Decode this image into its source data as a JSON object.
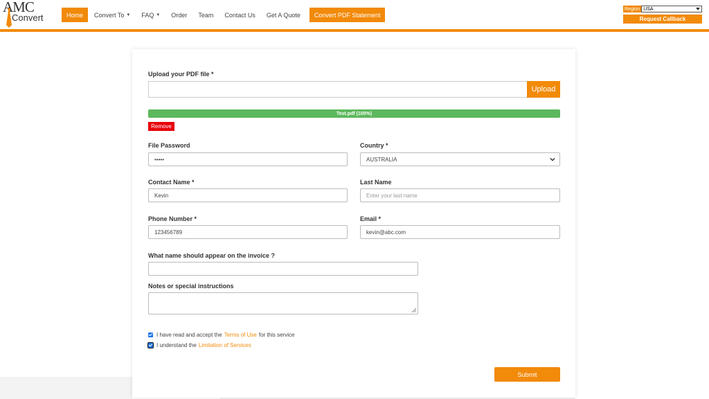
{
  "header": {
    "logo": {
      "top": "AMC",
      "bottom": "Convert"
    },
    "nav": [
      {
        "label": "Home",
        "active": true,
        "dropdown": false
      },
      {
        "label": "Convert To",
        "active": false,
        "dropdown": true
      },
      {
        "label": "FAQ",
        "active": false,
        "dropdown": true
      },
      {
        "label": "Order",
        "active": false,
        "dropdown": false
      },
      {
        "label": "Team",
        "active": false,
        "dropdown": false
      },
      {
        "label": "Contact Us",
        "active": false,
        "dropdown": false
      },
      {
        "label": "Get A Quote",
        "active": false,
        "dropdown": false
      },
      {
        "label": "Convert PDF Statement",
        "active": false,
        "dropdown": false
      }
    ],
    "region": {
      "label": "Region",
      "value": "USA"
    },
    "callback_label": "Request Callback"
  },
  "form": {
    "upload": {
      "label": "Upload your PDF file *",
      "button": "Upload",
      "value": ""
    },
    "progress": {
      "text": "Test.pdf (100%)",
      "percent": 100
    },
    "remove_label": "Remove",
    "file_password": {
      "label": "File Password",
      "value": "•••••"
    },
    "country": {
      "label": "Country *",
      "value": "AUSTRALIA"
    },
    "contact_name": {
      "label": "Contact Name *",
      "value": "Kevin"
    },
    "last_name": {
      "label": "Last Name",
      "placeholder": "Enter your last name"
    },
    "phone": {
      "label": "Phone Number *",
      "value": "123456789"
    },
    "email": {
      "label": "Email *",
      "value": "kevin@abc.com"
    },
    "invoice_name": {
      "label": "What name should appear on the invoice ?",
      "value": ""
    },
    "notes": {
      "label": "Notes or special instructions",
      "value": ""
    },
    "terms": {
      "prefix": "I have read and accept the",
      "link": "Terms of Use",
      "suffix": "for this service",
      "checked": true
    },
    "limitation": {
      "prefix": "I understand the",
      "link": "Limitation of Services",
      "checked": true
    },
    "submit_label": "Submit"
  },
  "colors": {
    "accent": "#f28a0a",
    "progress": "#5cb85c",
    "remove": "#e8000a",
    "checkbox": "#1a73e8"
  }
}
